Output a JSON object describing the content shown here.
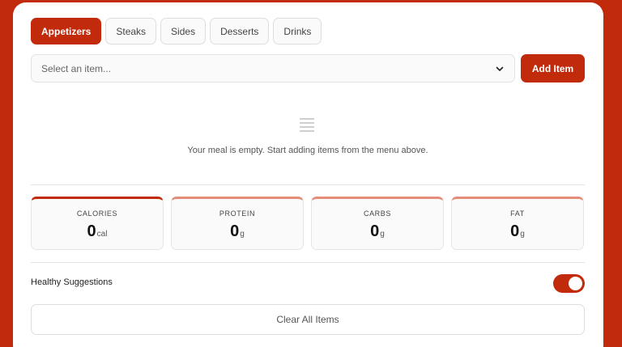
{
  "tabs": [
    {
      "label": "Appetizers",
      "active": true
    },
    {
      "label": "Steaks",
      "active": false
    },
    {
      "label": "Sides",
      "active": false
    },
    {
      "label": "Desserts",
      "active": false
    },
    {
      "label": "Drinks",
      "active": false
    }
  ],
  "select": {
    "placeholder": "Select an item..."
  },
  "add_button": {
    "label": "Add Item"
  },
  "empty_state": {
    "icon": "list-icon",
    "message": "Your meal is empty. Start adding items from the menu above."
  },
  "nutrition": [
    {
      "label": "CALORIES",
      "value": "0",
      "unit": "cal"
    },
    {
      "label": "PROTEIN",
      "value": "0",
      "unit": "g"
    },
    {
      "label": "CARBS",
      "value": "0",
      "unit": "g"
    },
    {
      "label": "FAT",
      "value": "0",
      "unit": "g"
    }
  ],
  "healthy": {
    "label": "Healthy Suggestions",
    "enabled": true
  },
  "clear_button": {
    "label": "Clear All Items"
  },
  "colors": {
    "accent": "#c22a0c",
    "accent_light": "#e48d78",
    "background": "#c22a0c"
  }
}
